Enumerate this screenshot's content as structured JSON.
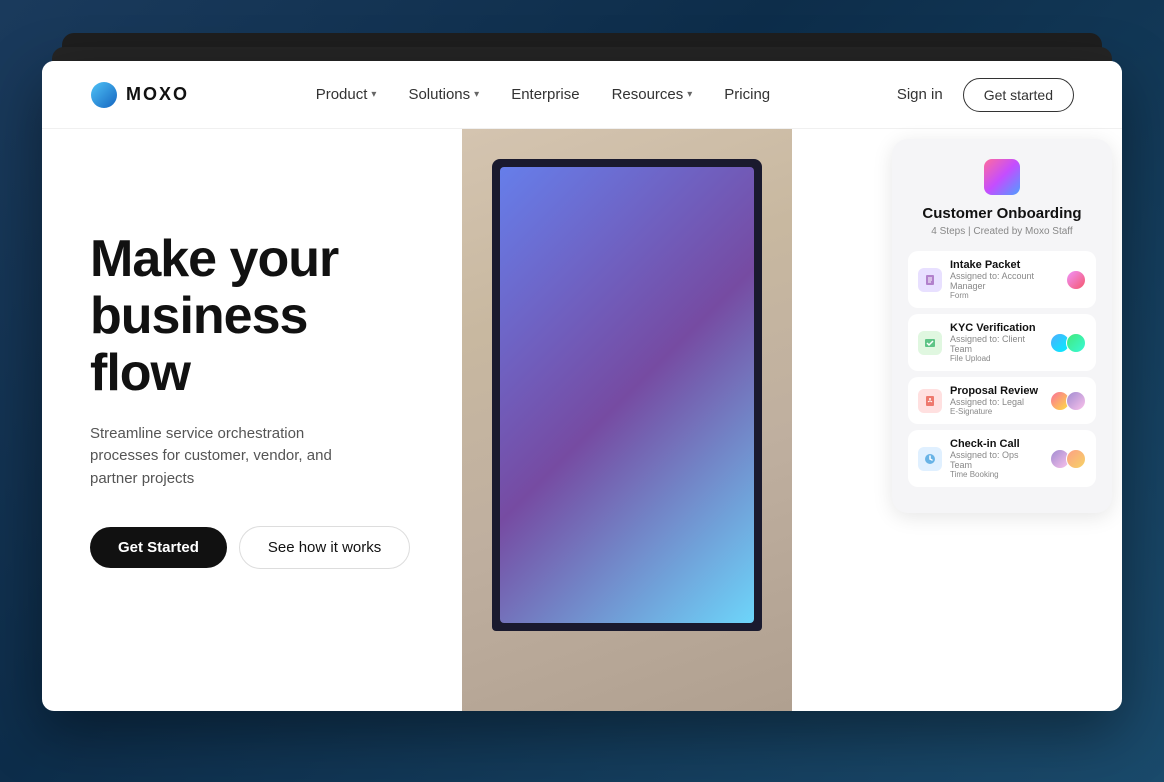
{
  "brand": {
    "logo_text": "MOXO",
    "logo_icon": "circle-gradient"
  },
  "nav": {
    "links": [
      {
        "label": "Product",
        "has_dropdown": true
      },
      {
        "label": "Solutions",
        "has_dropdown": true
      },
      {
        "label": "Enterprise",
        "has_dropdown": false
      },
      {
        "label": "Resources",
        "has_dropdown": true
      },
      {
        "label": "Pricing",
        "has_dropdown": false
      }
    ],
    "sign_in": "Sign in",
    "get_started": "Get started"
  },
  "hero": {
    "title": "Make your business flow",
    "subtitle": "Streamline service orchestration processes for customer, vendor, and partner projects",
    "btn_primary": "Get Started",
    "btn_secondary": "See how it works"
  },
  "onboarding_card": {
    "title": "Customer Onboarding",
    "subtitle": "4 Steps | Created by Moxo Staff",
    "tasks": [
      {
        "name": "Intake Packet",
        "assigned": "Assigned to: Account Manager",
        "badge": "Form",
        "icon_color": "purple",
        "avatars": [
          "av1"
        ]
      },
      {
        "name": "KYC Verification",
        "assigned": "Assigned to: Client Team",
        "badge": "File Upload",
        "icon_color": "green",
        "avatars": [
          "av2",
          "av3"
        ]
      },
      {
        "name": "Proposal Review",
        "assigned": "Assigned to: Legal",
        "badge": "E-Signature",
        "icon_color": "red",
        "avatars": [
          "av4",
          "av5"
        ]
      },
      {
        "name": "Check-in Call",
        "assigned": "Assigned to: Ops Team",
        "badge": "Time Booking",
        "icon_color": "blue",
        "avatars": [
          "av5",
          "av6"
        ]
      }
    ]
  }
}
